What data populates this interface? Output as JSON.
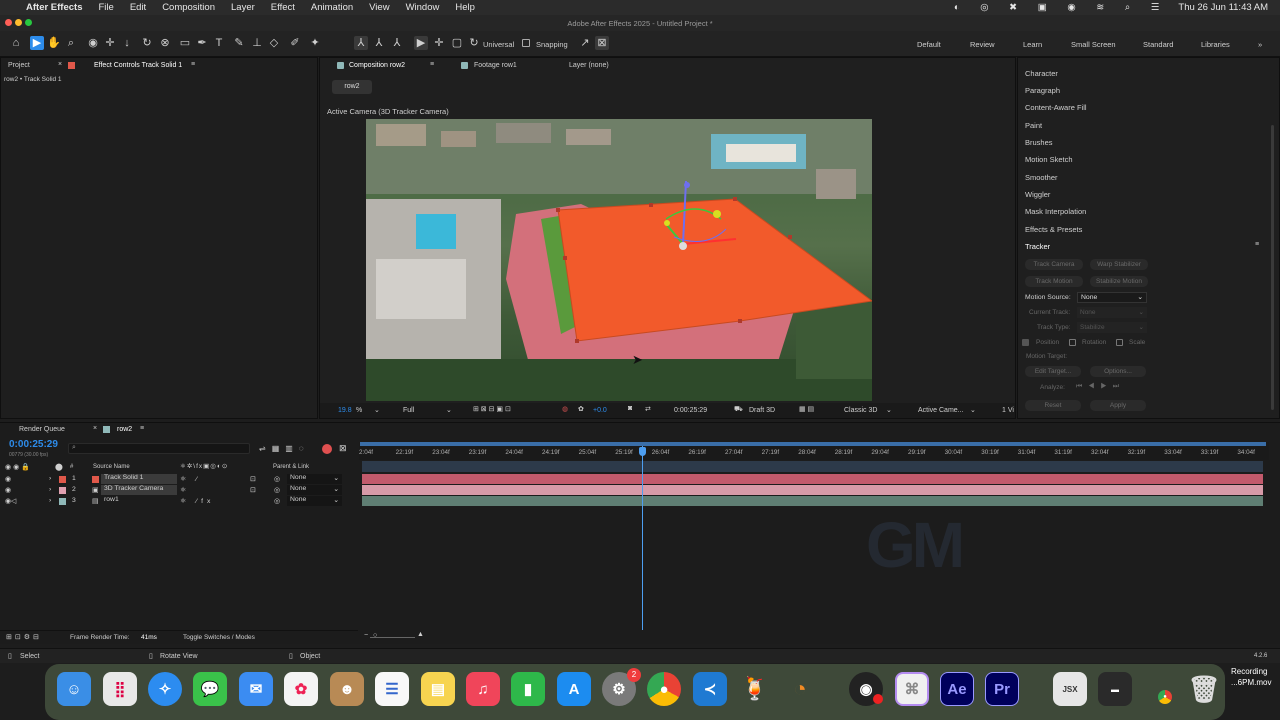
{
  "menubar": {
    "app_name": "After Effects",
    "items": [
      "File",
      "Edit",
      "Composition",
      "Layer",
      "Effect",
      "Animation",
      "View",
      "Window",
      "Help"
    ],
    "clock": "Thu 26 Jun  11:43 AM"
  },
  "window_title": "Adobe After Effects 2025 - Untitled Project *",
  "toolbar": {
    "universal_label": "Universal",
    "snapping_label": "Snapping",
    "workspaces": [
      "Default",
      "Review",
      "Learn",
      "Small Screen",
      "Standard",
      "Libraries"
    ]
  },
  "left_panel": {
    "tab_project": "Project",
    "tab_effect_controls": "Effect Controls Track Solid 1",
    "subtitle": "row2 • Track Solid 1"
  },
  "comp_panel": {
    "tabs": [
      "Composition row2",
      "Footage row1",
      "Layer (none)"
    ],
    "breadcrumb": "row2",
    "camera_label": "Active Camera (3D Tracker Camera)",
    "zoom": "19.8",
    "zoom_unit": "%",
    "resolution": "Full",
    "exposure": "+0.0",
    "timecode": "0:00:25:29",
    "draft": "Draft 3D",
    "renderer": "Classic 3D",
    "view": "Active Came...",
    "views_count": "1 Vi"
  },
  "right_panel": {
    "items": [
      "Character",
      "Paragraph",
      "Content-Aware Fill",
      "Paint",
      "Brushes",
      "Motion Sketch",
      "Smoother",
      "Wiggler",
      "Mask Interpolation",
      "Effects & Presets",
      "Tracker"
    ],
    "tracker": {
      "track_camera": "Track Camera",
      "warp_stabilizer": "Warp Stabilizer",
      "track_motion": "Track Motion",
      "stabilize_motion": "Stabilize Motion",
      "motion_source_label": "Motion Source:",
      "motion_source_value": "None",
      "current_track_label": "Current Track:",
      "current_track_value": "None",
      "track_type_label": "Track Type:",
      "track_type_value": "Stabilize",
      "position_label": "Position",
      "rotation_label": "Rotation",
      "scale_label": "Scale",
      "motion_target_label": "Motion Target:",
      "edit_target": "Edit Target...",
      "options": "Options...",
      "analyze_label": "Analyze:",
      "reset": "Reset",
      "apply": "Apply"
    }
  },
  "timeline": {
    "tab_render_queue": "Render Queue",
    "tab_comp": "row2",
    "timecode": "0:00:25:29",
    "timecode_sub": "00779 (30.00 fps)",
    "search_placeholder": "",
    "col_hash": "#",
    "col_source": "Source Name",
    "col_parent": "Parent & Link",
    "ticks": [
      "2:04f",
      "22:19f",
      "23:04f",
      "23:19f",
      "24:04f",
      "24:19f",
      "25:04f",
      "25:19f",
      "26:04f",
      "26:19f",
      "27:04f",
      "27:19f",
      "28:04f",
      "28:19f",
      "29:04f",
      "29:19f",
      "30:04f",
      "30:19f",
      "31:04f",
      "31:19f",
      "32:04f",
      "32:19f",
      "33:04f",
      "33:19f",
      "34:04f"
    ],
    "layers": [
      {
        "num": "1",
        "name": "Track Solid 1",
        "parent": "None",
        "color": "#e0584a"
      },
      {
        "num": "2",
        "name": "3D Tracker Camera",
        "parent": "None",
        "color": "#e0a0b0"
      },
      {
        "num": "3",
        "name": "row1",
        "parent": "None",
        "color": "#8fb8b8"
      }
    ],
    "frame_render_label": "Frame Render Time:",
    "frame_render_value": "41ms",
    "toggle_label": "Toggle Switches / Modes"
  },
  "statusbar": {
    "select": "Select",
    "rotate": "Rotate View",
    "object": "Object",
    "version": "4.2.6"
  },
  "dock": {
    "settings_badge": "2",
    "recording_line1": "Recording",
    "recording_line2": "...6PM.mov",
    "ae_label": "Ae",
    "pr_label": "Pr",
    "jsx_label": "JSX"
  },
  "colors": {
    "accent_blue": "#2d8ceb",
    "solid_orange": "#f25a2b",
    "track_pink": "#c98a95",
    "track_green": "#7aa07a"
  }
}
